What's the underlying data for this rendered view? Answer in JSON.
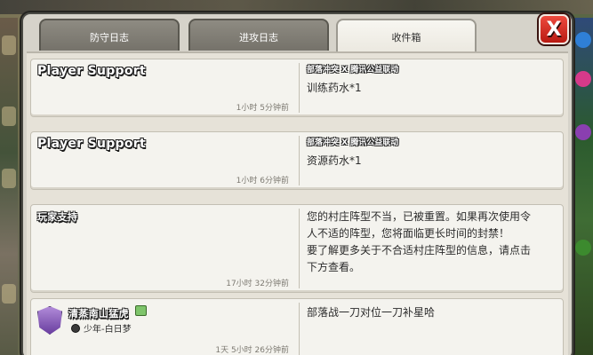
{
  "tabs": {
    "defense_log": "防守日志",
    "attack_log": "进攻日志",
    "inbox": "收件箱"
  },
  "close_label": "X",
  "messages": [
    {
      "sender": "Player Support",
      "time": "1小时 5分钟前",
      "tag": "部落冲突 X 腾讯公益联动",
      "text": "训练药水*1"
    },
    {
      "sender": "Player Support",
      "time": "1小时 6分钟前",
      "tag": "部落冲突 X 腾讯公益联动",
      "text": "资源药水*1"
    },
    {
      "sender": "玩家支持",
      "time": "17小时 32分钟前",
      "lines": [
        "您的村庄阵型不当，已被重置。如果再次使用令",
        "人不适的阵型，您将面临更长时间的封禁！",
        "要了解更多关于不合适村庄阵型的信息，请点击",
        "下方查看。"
      ]
    },
    {
      "sender": "清蒸南山猛虎",
      "role": "少年-白日梦",
      "time": "1天 5小时 26分钟前",
      "text": "部落战一刀对位一刀补星哈"
    }
  ]
}
